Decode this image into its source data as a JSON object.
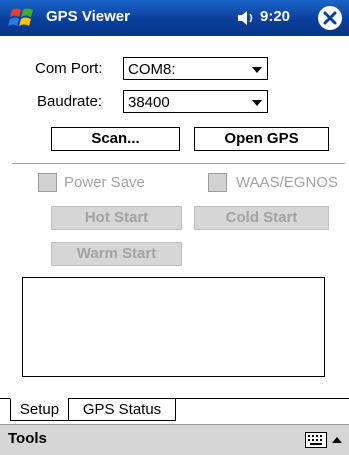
{
  "titlebar": {
    "app_title": "GPS Viewer",
    "time": "9:20",
    "icons": [
      "windows-start-icon",
      "speaker-icon",
      "close-icon"
    ]
  },
  "form": {
    "com_port": {
      "label": "Com Port:",
      "value": "COM8:"
    },
    "baudrate": {
      "label": "Baudrate:",
      "value": "38400"
    },
    "scan_label": "Scan...",
    "open_gps_label": "Open GPS",
    "power_save_label": "Power Save",
    "waas_label": "WAAS/EGNOS",
    "hot_start_label": "Hot Start",
    "cold_start_label": "Cold Start",
    "warm_start_label": "Warm Start"
  },
  "tabs": [
    {
      "label": "Setup",
      "active": true
    },
    {
      "label": "GPS Status",
      "active": false
    }
  ],
  "menubar": {
    "tools_label": "Tools"
  },
  "colors": {
    "titlebar": "#0a3f9c",
    "disabled_text": "#a3a3a3",
    "disabled_bg": "#d6d6d6"
  }
}
